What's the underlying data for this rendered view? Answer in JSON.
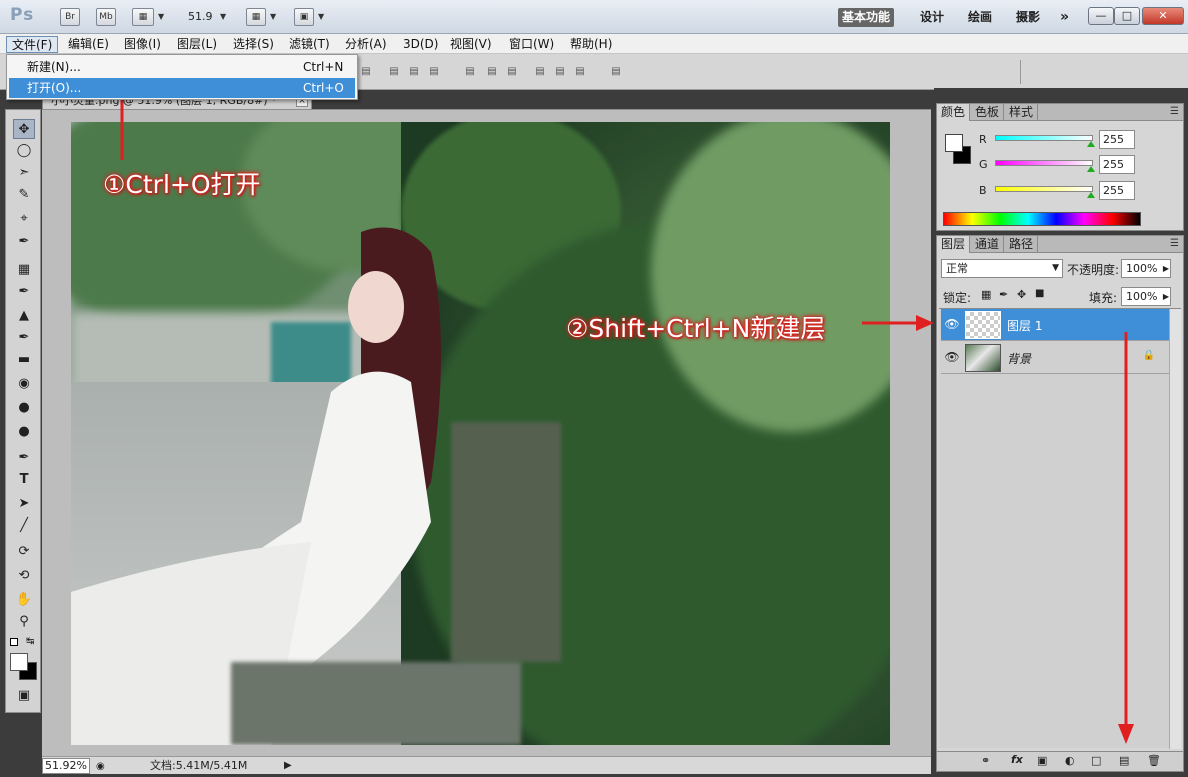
{
  "appbar": {
    "logo": "Ps",
    "bridge_label": "Br",
    "minibridge_label": "Mb",
    "zoom_value": "51.9",
    "workspaces": [
      "基本功能",
      "设计",
      "绘画",
      "摄影"
    ],
    "more_label": "»"
  },
  "menubar": {
    "items": [
      "文件(F)",
      "编辑(E)",
      "图像(I)",
      "图层(L)",
      "选择(S)",
      "滤镜(T)",
      "分析(A)",
      "3D(D)",
      "视图(V)",
      "窗口(W)",
      "帮助(H)"
    ]
  },
  "file_menu": {
    "items": [
      {
        "label": "新建(N)...",
        "shortcut": "Ctrl+N"
      },
      {
        "label": "打开(O)...",
        "shortcut": "Ctrl+O"
      }
    ]
  },
  "document": {
    "tab_title": "小小灵童.png @ 51.9% (图层 1, RGB/8#) *",
    "close": "×"
  },
  "status": {
    "zoom": "51.92%",
    "doc_info": "文档:5.41M/5.41M"
  },
  "color_panel": {
    "tabs": [
      "颜色",
      "色板",
      "样式"
    ],
    "channels": [
      {
        "name": "R",
        "value": "255"
      },
      {
        "name": "G",
        "value": "255"
      },
      {
        "name": "B",
        "value": "255"
      }
    ]
  },
  "layers_panel": {
    "tabs": [
      "图层",
      "通道",
      "路径"
    ],
    "blend_mode": "正常",
    "opacity_label": "不透明度:",
    "opacity_value": "100%",
    "lock_label": "锁定:",
    "fill_label": "填充:",
    "fill_value": "100%",
    "layers": [
      {
        "name": "图层 1",
        "selected": true
      },
      {
        "name": "背景",
        "selected": false
      }
    ]
  },
  "annotations": {
    "step1": "①Ctrl+O打开",
    "step2": "②Shift+Ctrl+N新建层"
  },
  "colors": {
    "selection_blue": "#3f8fd8",
    "annotation_red": "#e02020"
  }
}
